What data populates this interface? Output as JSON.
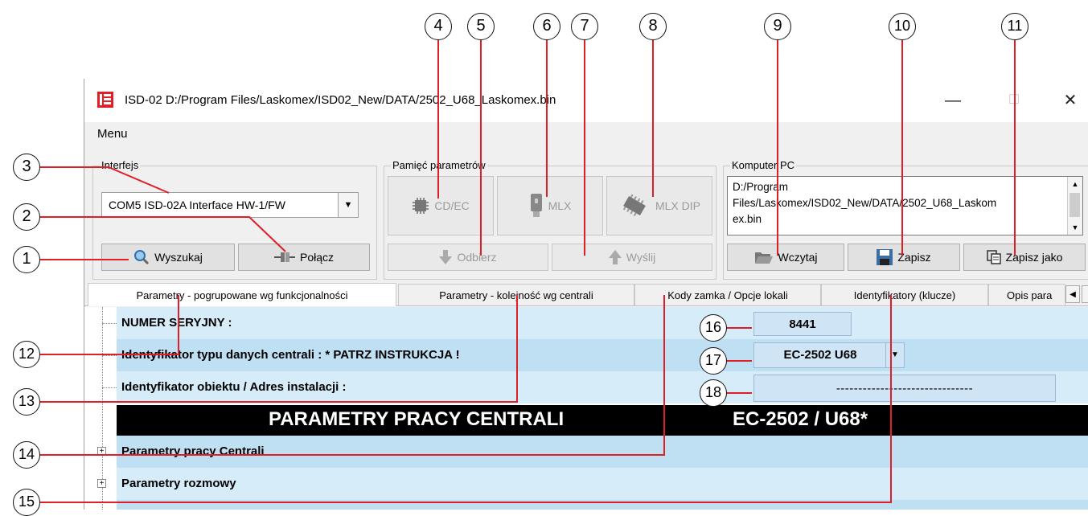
{
  "window": {
    "title": "ISD-02  D:/Program Files/Laskomex/ISD02_New/DATA/2502_U68_Laskomex.bin",
    "minimize": "—",
    "maximize": "☐",
    "close": "✕"
  },
  "menu": {
    "label": "Menu"
  },
  "interface_group": {
    "label": "Interfejs",
    "port_value": "COM5 ISD-02A Interface  HW-1/FW",
    "search_button": "Wyszukaj",
    "connect_button": "Połącz"
  },
  "memory_group": {
    "label": "Pamięć parametrów",
    "cdec_button": "CD/EC",
    "mlx_button": "MLX",
    "mlxdip_button": "MLX DIP",
    "receive_button": "Odbierz",
    "send_button": "Wyślij"
  },
  "pc_group": {
    "label": "Komputer PC",
    "path_line1": "D:/Program",
    "path_line2": "Files/Laskomex/ISD02_New/DATA/2502_U68_Laskom",
    "path_line3": "ex.bin",
    "load_button": "Wczytaj",
    "save_button": "Zapisz",
    "saveas_button": "Zapisz jako"
  },
  "tabs": [
    {
      "label": "Parametry - pogrupowane wg funkcjonalności"
    },
    {
      "label": "Parametry - kolejność wg centrali"
    },
    {
      "label": "Kody zamka / Opcje lokali"
    },
    {
      "label": "Identyfikatory (klucze)"
    },
    {
      "label": "Opis para"
    }
  ],
  "tree": {
    "serial_label": "NUMER SERYJNY :",
    "serial_value": "8441",
    "type_label": "Identyfikator typu danych centrali :   * PATRZ INSTRUKCJA !",
    "type_value": "EC-2502 U68",
    "object_label": "Identyfikator obiektu / Adres instalacji :",
    "object_value": "-------------------------------",
    "header_left": "PARAMETRY  PRACY  CENTRALI",
    "header_right": "EC-2502 / U68*",
    "group1": "Parametry pracy Centrali",
    "group2": "Parametry rozmowy"
  },
  "callouts": [
    "1",
    "2",
    "3",
    "4",
    "5",
    "6",
    "7",
    "8",
    "9",
    "10",
    "11",
    "12",
    "13",
    "14",
    "15",
    "16",
    "17",
    "18"
  ],
  "colors": {
    "row_light": "#d6ecf8",
    "row_mid": "#bfe0f3",
    "header_bg": "#000000",
    "accent_logo": "#e01e26"
  }
}
